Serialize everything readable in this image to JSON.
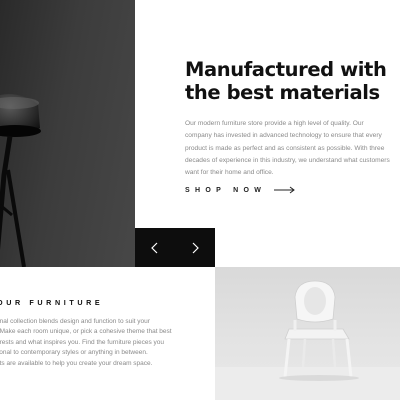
{
  "hero": {
    "title_line1": "Manufactured with",
    "title_line2": "the best materials",
    "body": "Our modern furniture store provide a high level of quality. Our company has invested in advanced technology to ensure that every product is made as perfect and as consistent as possible. With three decades of experience in this industry, we understand what customers want for their home and office.",
    "cta_label": "SHOP NOW",
    "cta_icon": "arrow-right-icon"
  },
  "slider": {
    "prev_icon": "chevron-left-icon",
    "next_icon": "chevron-right-icon"
  },
  "section_two": {
    "heading": "OUR FURNITURE",
    "body": "onal collection blends design and function to suit your\n. Make each room unique, or pick a cohesive theme that best\nerests and what inspires you. Find the furniture pieces you\ntional to contemporary styles or anything in between.\nets are available to help you create your dream space."
  },
  "colors": {
    "dark_panel": "#0d0d0d",
    "text_dark": "#111111",
    "text_muted": "#8a8a8a"
  }
}
